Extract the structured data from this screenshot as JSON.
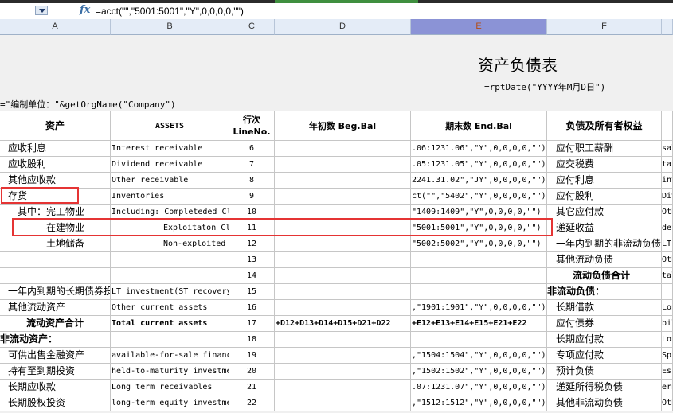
{
  "formula_bar": {
    "formula": "=acct(\"\",\"5001:5001\",\"Y\",0,0,0,0,\"\")"
  },
  "columns": [
    "A",
    "B",
    "C",
    "D",
    "E",
    "F"
  ],
  "sheet": {
    "title": "资产负债表",
    "date_formula": "=rptDate(\"YYYY年M月D日\")",
    "unit_formula": "=\"编制单位：\"&getOrgName(\"Company\")",
    "headers": {
      "assets_zh": "资产",
      "assets_en": "ASSETS",
      "line_no": "行次\nLineNo.",
      "beg_bal": "年初数 Beg.Bal",
      "end_bal": "期末数 End.Bal",
      "liab": "负债及所有者权益"
    },
    "rows": [
      {
        "a": "应收利息",
        "b": "Interest receivable",
        "c": "6",
        "e": ".06:1231.06\",\"Y\",0,0,0,0,\"\")",
        "f": "应付职工薪酬",
        "g": "sal"
      },
      {
        "a": "应收股利",
        "b": "Dividend receivable",
        "c": "7",
        "e": ".05:1231.05\",\"Y\",0,0,0,0,\"\")",
        "f": "应交税费",
        "g": "tax"
      },
      {
        "a": "其他应收款",
        "b": "Other receivable",
        "c": "8",
        "e": "2241.31.02\",\"JY\",0,0,0,0,\"\")",
        "f": "应付利息",
        "g": "int"
      },
      {
        "a": "存货",
        "b": "Inventories",
        "c": "9",
        "e": "ct(\"\",\"5402\",\"Y\",0,0,0,0,\"\")",
        "f": "应付股利",
        "g": "Div"
      },
      {
        "a": "其中：完工物业",
        "b": "Including: Completeded Cl",
        "c": "10",
        "e": "\"1409:1409\",\"Y\",0,0,0,0,\"\")",
        "f": "其它应付款",
        "g": "Oth"
      },
      {
        "a": "在建物业",
        "b": "Exploitaton Cl",
        "c": "11",
        "e": "\"5001:5001\",\"Y\",0,0,0,0,\"\")",
        "f": "递延收益",
        "g": "def"
      },
      {
        "a": "土地储备",
        "b": "Non-exploited",
        "c": "12",
        "e": "\"5002:5002\",\"Y\",0,0,0,0,\"\")",
        "f": "一年内到期的非流动负债",
        "g": "LT"
      },
      {
        "a": "",
        "b": "",
        "c": "13",
        "e": "",
        "f": "其他流动负债",
        "g": "Oth"
      },
      {
        "a": "",
        "b": "",
        "c": "14",
        "e": "",
        "f": "流动负债合计",
        "g": "tal"
      },
      {
        "a": "一年内到期的长期债券投",
        "b": "LT investment(ST recovery",
        "c": "15",
        "e": "",
        "f": "非流动负债：",
        "g": ""
      },
      {
        "a": "其他流动资产",
        "b": "Other current assets",
        "c": "16",
        "e": ",\"1901:1901\",\"Y\",0,0,0,0,\"\")",
        "f": "长期借款",
        "g": "Lon"
      },
      {
        "a": "流动资产合计",
        "b": "Total current assets",
        "c": "17",
        "d": "+D12+D13+D14+D15+D21+D22",
        "e": "+E12+E13+E14+E15+E21+E22",
        "f": "应付债券",
        "g": "bil"
      },
      {
        "a": "非流动资产：",
        "b": "",
        "c": "18",
        "e": "",
        "f": "长期应付款",
        "g": "Lon"
      },
      {
        "a": "可供出售金融资产",
        "b": "available-for-sale financ",
        "c": "19",
        "e": ",\"1504:1504\",\"Y\",0,0,0,0,\"\")",
        "f": "专项应付款",
        "g": "Sp"
      },
      {
        "a": "持有至到期投资",
        "b": "held-to-maturity investme",
        "c": "20",
        "e": ",\"1502:1502\",\"Y\",0,0,0,0,\"\")",
        "f": "预计负债",
        "g": "Es"
      },
      {
        "a": "长期应收款",
        "b": "Long term receivables",
        "c": "21",
        "e": ".07:1231.07\",\"Y\",0,0,0,0,\"\")",
        "f": "递延所得税负债",
        "g": "ern"
      },
      {
        "a": "长期股权投资",
        "b": "long-term equity investme",
        "c": "22",
        "e": ",\"1512:1512\",\"Y\",0,0,0,0,\"\")",
        "f": "其他非流动负债",
        "g": "Oth"
      }
    ]
  }
}
